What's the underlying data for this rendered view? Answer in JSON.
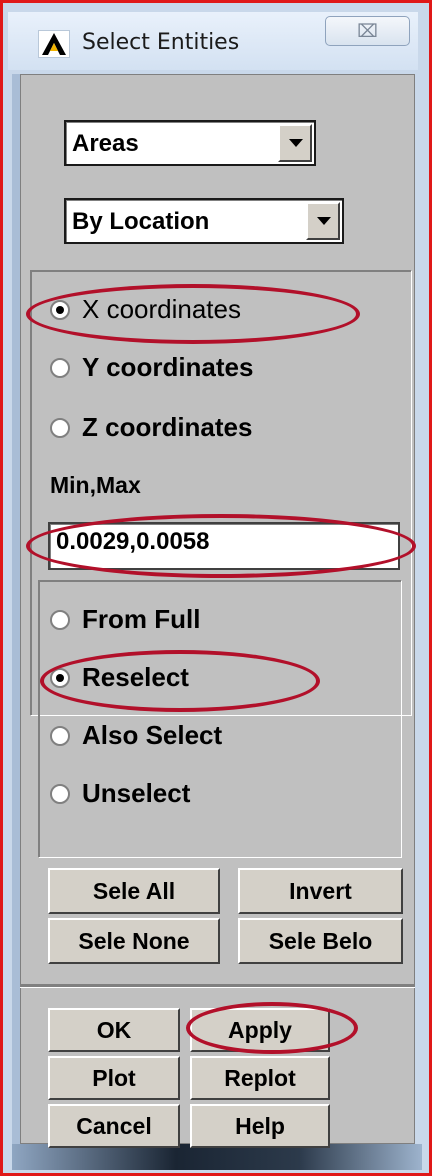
{
  "window": {
    "title": "Select Entities",
    "close_glyph": "⌧"
  },
  "entity_select": {
    "value": "Areas"
  },
  "criteria_select": {
    "value": "By Location"
  },
  "coordinate_options": [
    {
      "label": "X coordinates",
      "selected": true
    },
    {
      "label": "Y coordinates",
      "selected": false
    },
    {
      "label": "Z coordinates",
      "selected": false
    }
  ],
  "minmax": {
    "label": "Min,Max",
    "value": "0.0029,0.0058"
  },
  "selection_mode_options": [
    {
      "label": "From Full",
      "selected": false
    },
    {
      "label": "Reselect",
      "selected": true
    },
    {
      "label": "Also Select",
      "selected": false
    },
    {
      "label": "Unselect",
      "selected": false
    }
  ],
  "selection_buttons": {
    "sele_all": "Sele All",
    "invert": "Invert",
    "sele_none": "Sele None",
    "sele_belo": "Sele Belo"
  },
  "action_buttons": {
    "ok": "OK",
    "apply": "Apply",
    "plot": "Plot",
    "replot": "Replot",
    "cancel": "Cancel",
    "help": "Help"
  },
  "colors": {
    "highlight_outline": "#b2102a",
    "frame_border": "#e01818",
    "dialog_bg": "#c0c0c0"
  },
  "icons": {
    "app": "ansys-logo-icon",
    "close": "close-icon",
    "dropdown": "chevron-down-icon"
  }
}
